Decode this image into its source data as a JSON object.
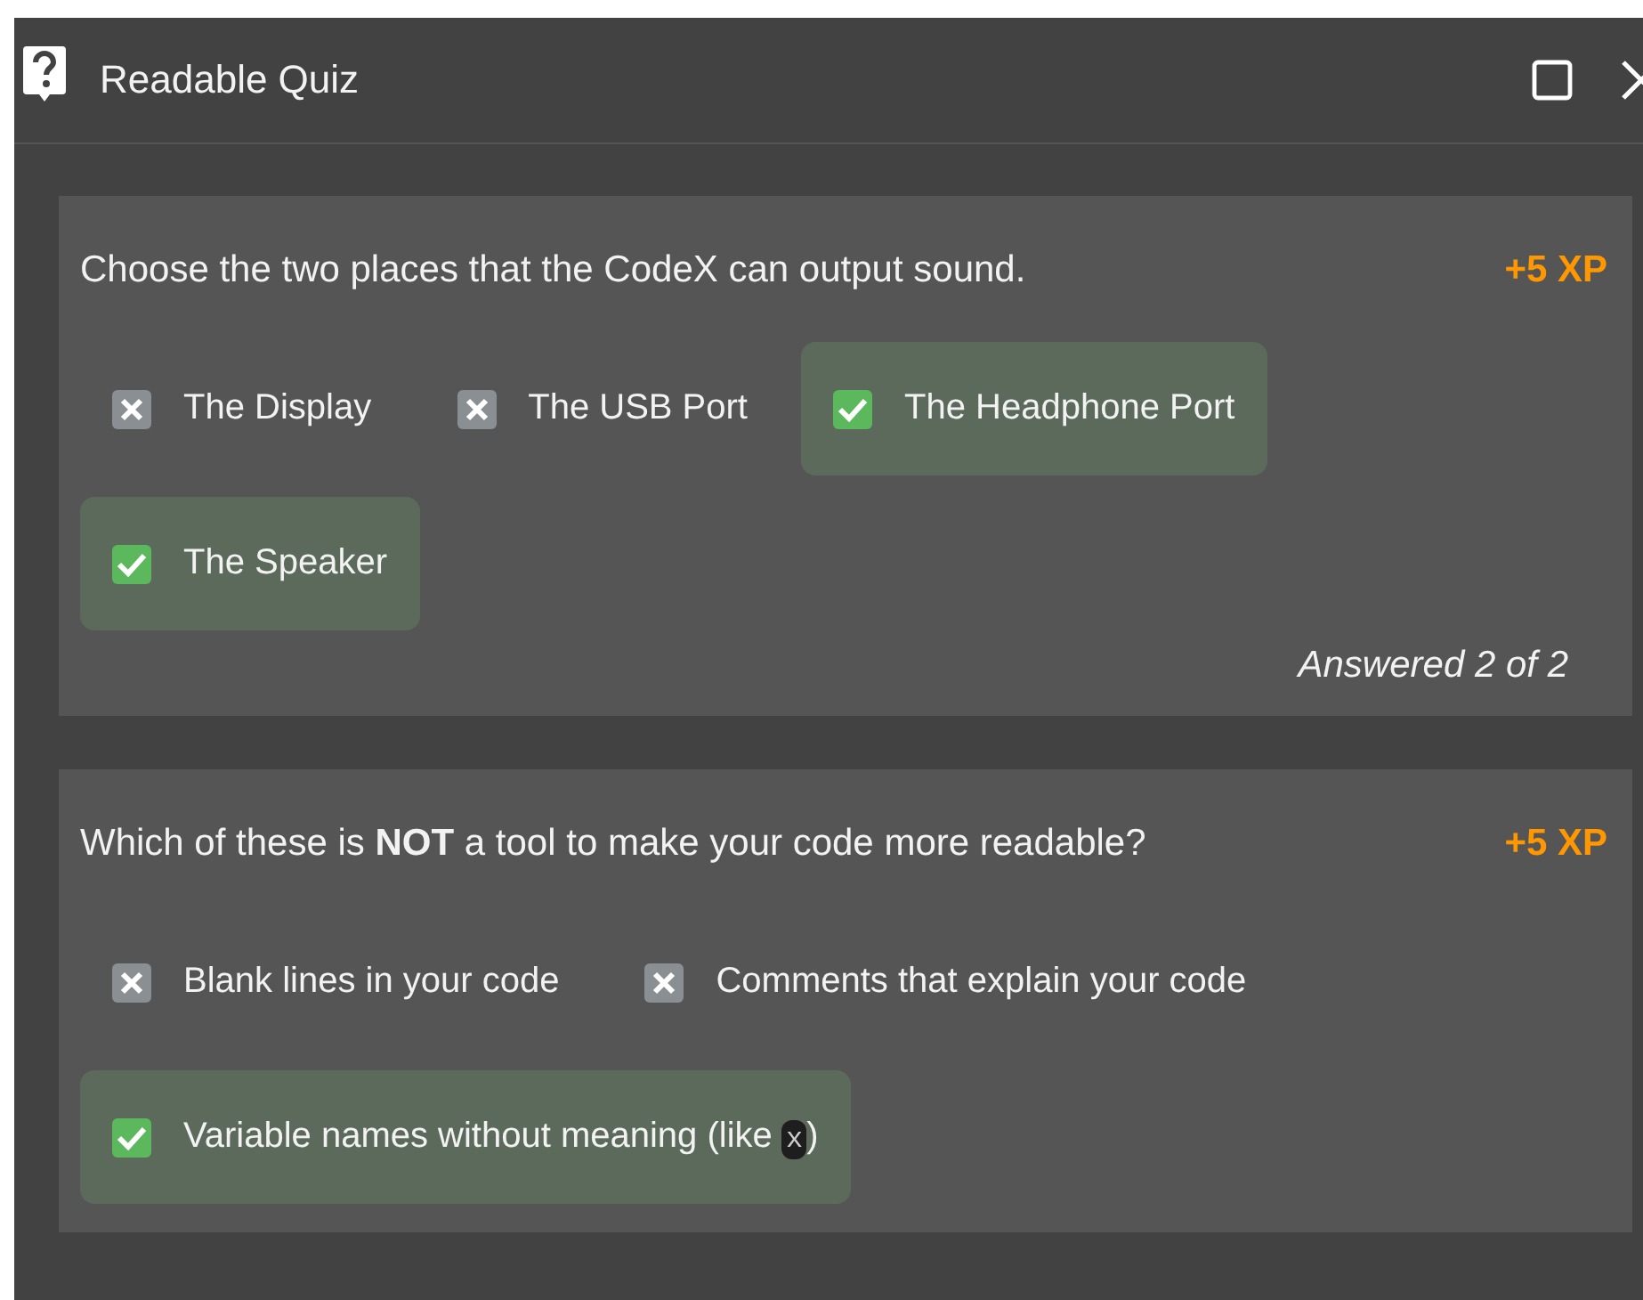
{
  "window": {
    "title": "Readable Quiz"
  },
  "questions": [
    {
      "text": "Choose the two places that the CodeX can output sound.",
      "xp": "+5 XP",
      "options": [
        {
          "label": "The Display",
          "selected": false
        },
        {
          "label": "The USB Port",
          "selected": false
        },
        {
          "label": "The Headphone Port",
          "selected": true
        },
        {
          "label": "The Speaker",
          "selected": true
        }
      ],
      "status": "Answered 2 of 2"
    },
    {
      "text": "Which of these is **NOT** a tool to make your code more readable?",
      "xp": "+5 XP",
      "options": [
        {
          "label": "Blank lines in your code",
          "selected": false
        },
        {
          "label": "Comments that explain your code",
          "selected": false
        },
        {
          "label": "Variable names without meaning (like ",
          "code": "x",
          "suffix": ")",
          "selected": true
        }
      ]
    }
  ]
}
